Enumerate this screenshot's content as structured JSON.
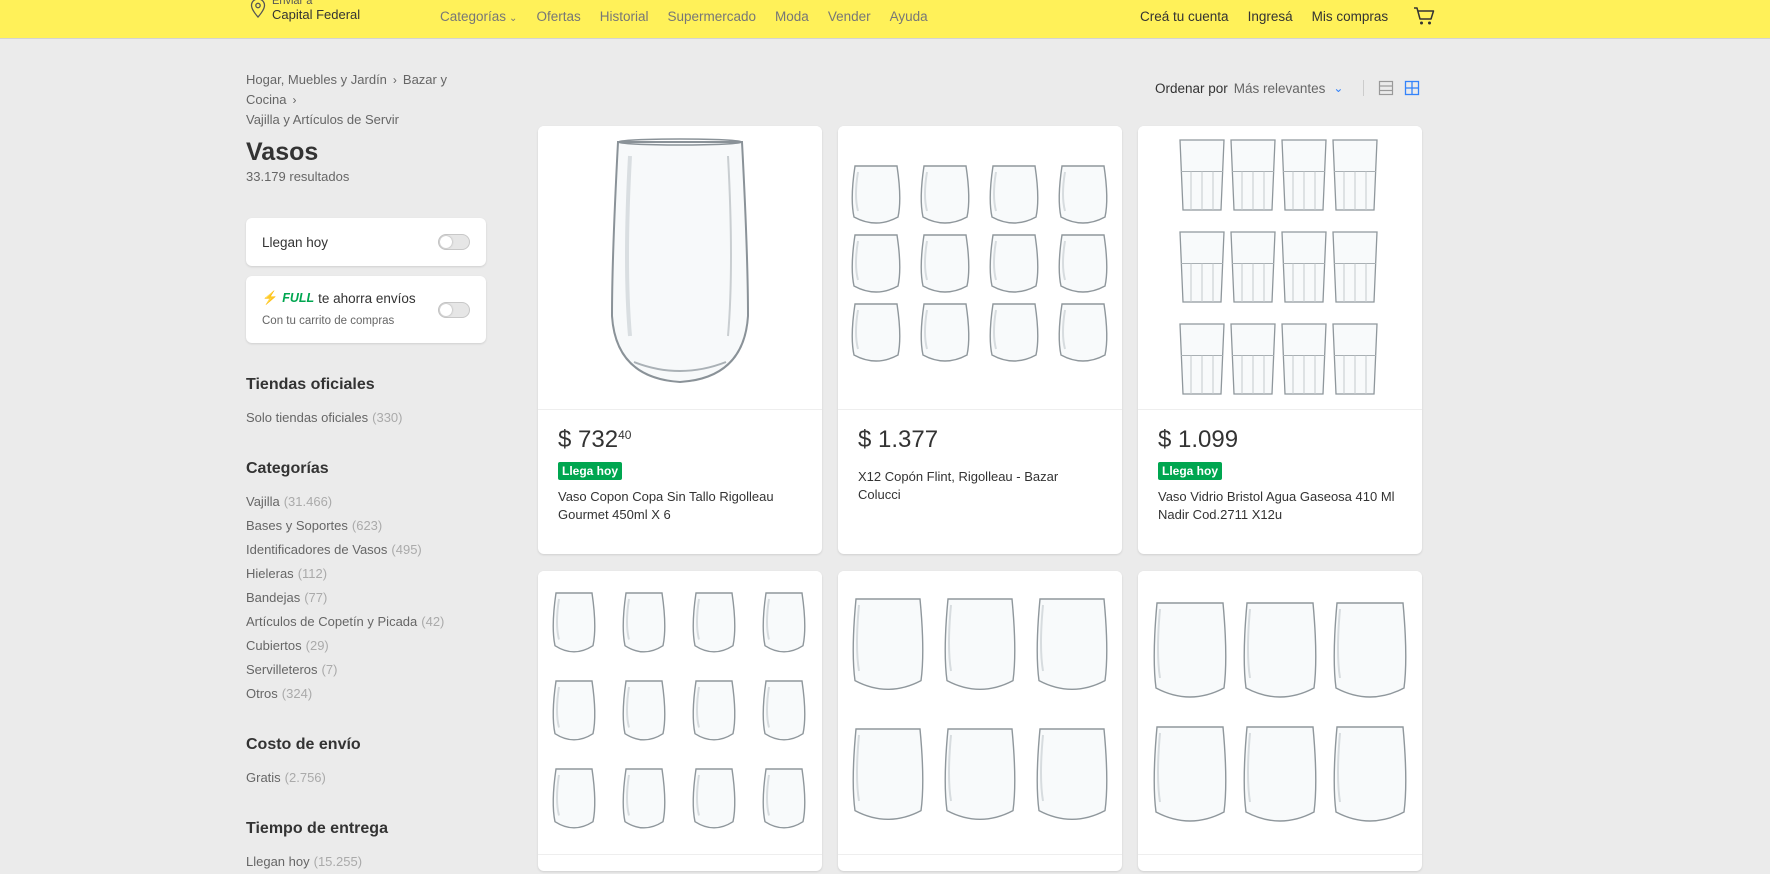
{
  "header": {
    "location_small": "Enviar a",
    "location_big": "Capital Federal",
    "nav": [
      "Categorías",
      "Ofertas",
      "Historial",
      "Supermercado",
      "Moda",
      "Vender",
      "Ayuda"
    ],
    "user_links": [
      "Creá tu cuenta",
      "Ingresá",
      "Mis compras"
    ]
  },
  "breadcrumb": [
    "Hogar, Muebles y Jardín",
    "Bazar y Cocina",
    "Vajilla y Artículos de Servir"
  ],
  "page_title": "Vasos",
  "result_count": "33.179 resultados",
  "filters": {
    "llegan_hoy": "Llegan hoy",
    "full_brand": "FULL",
    "full_text": "te ahorra envíos",
    "full_sub": "Con tu carrito de compras"
  },
  "sections": {
    "tiendas": {
      "title": "Tiendas oficiales",
      "items": [
        {
          "label": "Solo tiendas oficiales",
          "count": "(330)"
        }
      ]
    },
    "categorias": {
      "title": "Categorías",
      "items": [
        {
          "label": "Vajilla",
          "count": "(31.466)"
        },
        {
          "label": "Bases y Soportes",
          "count": "(623)"
        },
        {
          "label": "Identificadores de Vasos",
          "count": "(495)"
        },
        {
          "label": "Hieleras",
          "count": "(112)"
        },
        {
          "label": "Bandejas",
          "count": "(77)"
        },
        {
          "label": "Artículos de Copetín y Picada",
          "count": "(42)"
        },
        {
          "label": "Cubiertos",
          "count": "(29)"
        },
        {
          "label": "Servilleteros",
          "count": "(7)"
        },
        {
          "label": "Otros",
          "count": "(324)"
        }
      ]
    },
    "envio": {
      "title": "Costo de envío",
      "items": [
        {
          "label": "Gratis",
          "count": "(2.756)"
        }
      ]
    },
    "entrega": {
      "title": "Tiempo de entrega",
      "items": [
        {
          "label": "Llegan hoy",
          "count": "(15.255)"
        }
      ]
    }
  },
  "sort": {
    "label": "Ordenar por",
    "value": "Más relevantes"
  },
  "products": [
    {
      "price": "$ 732",
      "cents": "40",
      "badge": "Llega hoy",
      "title": "Vaso Copon Copa Sin Tallo Rigolleau Gourmet 450ml X 6"
    },
    {
      "price": "$ 1.377",
      "cents": "",
      "badge": "",
      "title": "X12 Copón Flint, Rigolleau - Bazar Colucci"
    },
    {
      "price": "$ 1.099",
      "cents": "",
      "badge": "Llega hoy",
      "title": "Vaso Vidrio Bristol Agua Gaseosa 410 Ml Nadir Cod.2711 X12u"
    }
  ],
  "colors": {
    "header_bg": "#fff159",
    "badge_green": "#00a650",
    "accent_blue": "#3483fa"
  }
}
